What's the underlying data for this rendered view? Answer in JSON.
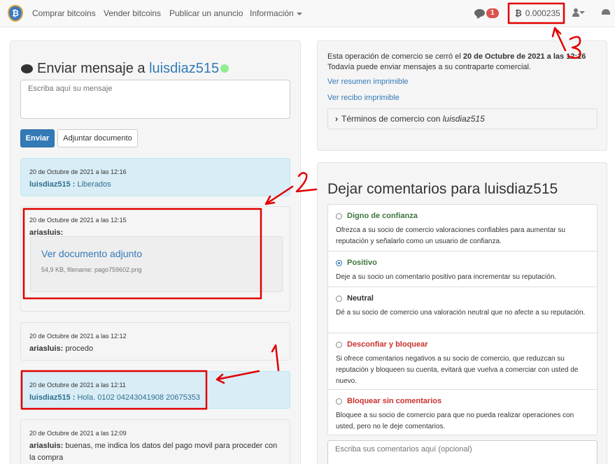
{
  "navbar": {
    "logo_glyph": "₿",
    "items": [
      {
        "label": "Comprar bitcoins"
      },
      {
        "label": "Vender bitcoins"
      },
      {
        "label": "Publicar un anuncio"
      },
      {
        "label": "Información"
      }
    ],
    "notification_count": "1",
    "balance": "0.000235"
  },
  "chat": {
    "title_prefix": "Enviar mensaje a",
    "title_user": "luisdiaz515",
    "online_color": "#90ee90",
    "message_placeholder": "Escriba aquí su mensaje",
    "send_label": "Enviar",
    "attach_label": "Adjuntar documento",
    "messages": [
      {
        "timestamp": "20 de Octubre de 2021 a las 12:16",
        "author": "luisdiaz515 :",
        "text": "Liberados"
      },
      {
        "timestamp": "20 de Octubre de 2021 a las 12:15",
        "author": "ariasluis:",
        "attachment_link": "Ver documento adjunto",
        "attachment_meta": "54,9 KB, filename: pago759602.png"
      },
      {
        "timestamp": "20 de Octubre de 2021 a las 12:12",
        "author": "ariasluis:",
        "text": "procedo"
      },
      {
        "timestamp": "20 de Octubre de 2021 a las 12:11",
        "author": "luisdiaz515 :",
        "text": "Hola. 0102 04243041908 20675353"
      },
      {
        "timestamp": "20 de Octubre de 2021 a las 12:09",
        "author": "ariasluis:",
        "text": "buenas, me indica los datos del pago movil para proceder con la compra"
      }
    ]
  },
  "trade": {
    "closed_prefix": "Esta operación de comercio se cerró el",
    "closed_date": "20 de Octubre de 2021 a las 12:16",
    "closed_note": "Todavía puede enviar mensajes a su contraparte comercial.",
    "printable_summary": "Ver resumen imprimible",
    "printable_receipt": "Ver recibo imprimible",
    "terms_prefix": "Términos de comercio con",
    "terms_user": "luisdiaz515"
  },
  "feedback": {
    "title": "Dejar comentarios para luisdiaz515",
    "options": [
      {
        "label": "Digno de confianza",
        "color": "#3c763d",
        "checked": false,
        "desc": "Ofrezca a su socio de comercio valoraciones confiables para aumentar su reputación y señalarlo como un usuario de confianza."
      },
      {
        "label": "Positivo",
        "color": "#3c763d",
        "checked": true,
        "desc": "Deje a su socio un comentario positivo para incrementar su reputación."
      },
      {
        "label": "Neutral",
        "color": "#333333",
        "checked": false,
        "desc": "Dé a su socio de comercio una valoración neutral que no afecte a su reputación."
      },
      {
        "label": "Desconfiar y bloquear",
        "color": "#c9302c",
        "checked": false,
        "desc": "Si ofrece comentarios negativos a su socio de comercio, que reduzcan su reputación y bloqueen su cuenta, evitará que vuelva a comerciar con usted de nuevo."
      },
      {
        "label": "Bloquear sin comentarios",
        "color": "#c9302c",
        "checked": false,
        "desc": "Bloquee a su socio de comercio para que no pueda realizar operaciones con usted, pero no le deje comentarios."
      }
    ],
    "comment_placeholder": "Escriba sus comentarios aquí (opcional)"
  },
  "annotations": {
    "color": "#e00000",
    "labels": [
      "1",
      "2",
      "3"
    ]
  }
}
